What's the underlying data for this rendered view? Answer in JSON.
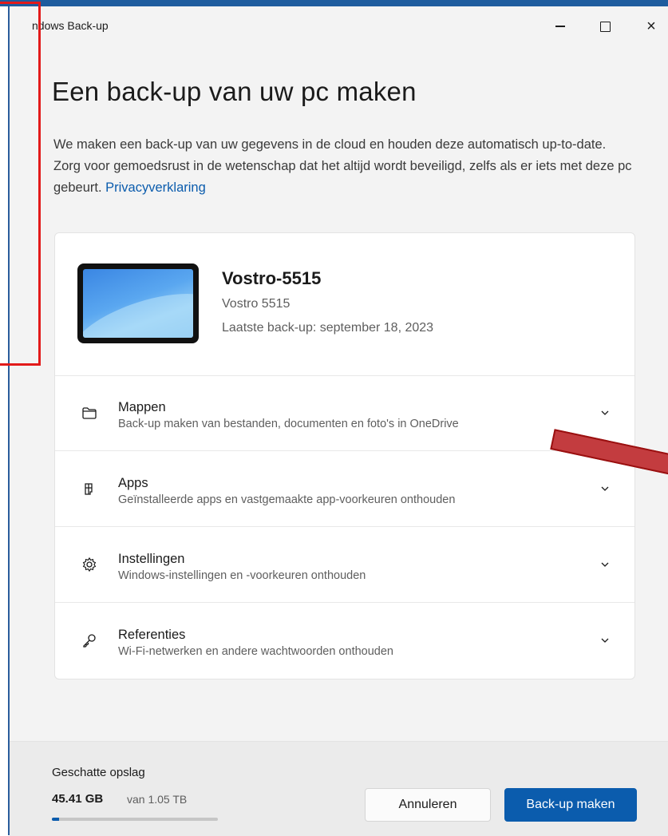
{
  "window": {
    "title": "ndows Back-up",
    "controls": {
      "minimize": "minimize",
      "maximize": "maximize",
      "close": "×"
    }
  },
  "page": {
    "heading": "Een back-up van uw pc maken",
    "description": "We maken een back-up van uw gegevens in de cloud en houden deze automatisch up-to-date. Zorg voor gemoedsrust in de wetenschap dat het altijd wordt beveiligd, zelfs als er iets met deze pc gebeurt.",
    "privacy_link": "Privacyverklaring"
  },
  "device": {
    "name": "Vostro-5515",
    "model": "Vostro 5515",
    "last_backup": "Laatste back-up: september 18, 2023"
  },
  "sections": [
    {
      "label": "Mappen",
      "sub": "Back-up maken van bestanden, documenten en foto's in OneDrive",
      "icon": "folder-icon"
    },
    {
      "label": "Apps",
      "sub": "Geïnstalleerde apps en vastgemaakte app-voorkeuren onthouden",
      "icon": "apps-icon"
    },
    {
      "label": "Instellingen",
      "sub": "Windows-instellingen en -voorkeuren onthouden",
      "icon": "gear-icon"
    },
    {
      "label": "Referenties",
      "sub": "Wi-Fi-netwerken en andere wachtwoorden onthouden",
      "icon": "key-icon"
    }
  ],
  "footer": {
    "storage_title": "Geschatte opslag",
    "storage_used": "45.41 GB",
    "storage_total": "van 1.05 TB",
    "storage_fraction": 0.043,
    "cancel_label": "Annuleren",
    "primary_label": "Back-up maken"
  },
  "colors": {
    "accent": "#0b5cad",
    "annotation": "#e21a1a"
  }
}
